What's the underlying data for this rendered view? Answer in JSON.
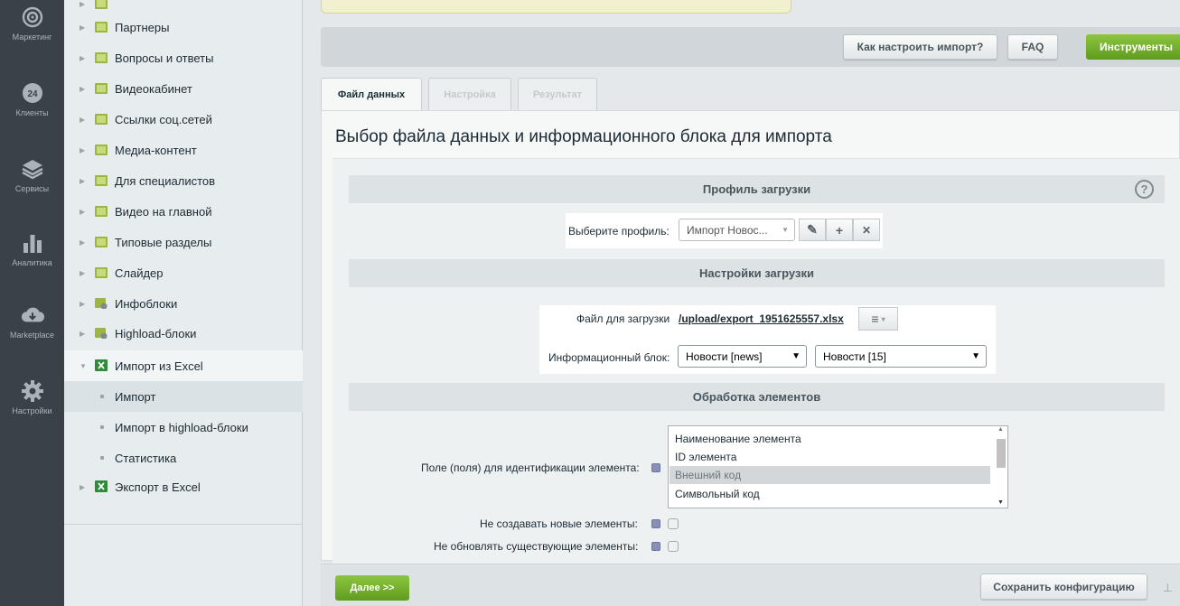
{
  "leftbar": {
    "items": [
      {
        "label": "Маркетинг",
        "icon": "target-icon"
      },
      {
        "label": "Клиенты",
        "icon": "24-icon"
      },
      {
        "label": "Сервисы",
        "icon": "layers-icon"
      },
      {
        "label": "Аналитика",
        "icon": "bar-chart-icon"
      },
      {
        "label": "Marketplace",
        "icon": "cloud-download-icon"
      },
      {
        "label": "Настройки",
        "icon": "gear-icon"
      }
    ]
  },
  "sidebar": {
    "items": [
      {
        "label": "Партнеры"
      },
      {
        "label": "Вопросы и ответы"
      },
      {
        "label": "Видеокабинет"
      },
      {
        "label": "Ссылки соц.сетей"
      },
      {
        "label": "Медиа-контент"
      },
      {
        "label": "Для специалистов"
      },
      {
        "label": "Видео на главной"
      },
      {
        "label": "Типовые разделы"
      },
      {
        "label": "Слайдер"
      },
      {
        "label": "Инфоблоки"
      },
      {
        "label": "Highload-блоки"
      },
      {
        "label": "Импорт из Excel"
      },
      {
        "label": "Импорт"
      },
      {
        "label": "Импорт в highload-блоки"
      },
      {
        "label": "Статистика"
      },
      {
        "label": "Экспорт в Excel"
      }
    ]
  },
  "toolbar": {
    "how_to": "Как настроить импорт?",
    "faq": "FAQ",
    "tools": "Инструменты"
  },
  "tabs": [
    "Файл данных",
    "Настройка",
    "Результат"
  ],
  "page": {
    "title": "Выбор файла данных и информационного блока для импорта"
  },
  "profile": {
    "section": "Профиль загрузки",
    "help": "?",
    "label": "Выберите профиль:",
    "value": "Импорт Новос..."
  },
  "load_settings": {
    "section": "Настройки загрузки",
    "file_label": "Файл для загрузки",
    "file_link": "/upload/export_1951625557.xlsx",
    "iblock_label": "Информационный блок:",
    "iblock_type": "Новости [news]",
    "iblock": "Новости [15]"
  },
  "processing": {
    "section": "Обработка элементов",
    "id_fields_label": "Поле (поля) для идентификации элемента:",
    "id_fields_options": [
      "Наименование элемента",
      "ID элемента",
      "Внешний код",
      "Символьный код"
    ],
    "id_fields_selected": "Внешний код",
    "no_create_label": "Не создавать новые элементы:",
    "no_update_label": "Не обновлять существующие элементы:"
  },
  "bottom": {
    "next": "Далее >>",
    "save_config": "Сохранить конфигурацию"
  },
  "colors": {
    "accent_green": "#6ab02c",
    "leftbar_bg": "#3a4248"
  }
}
